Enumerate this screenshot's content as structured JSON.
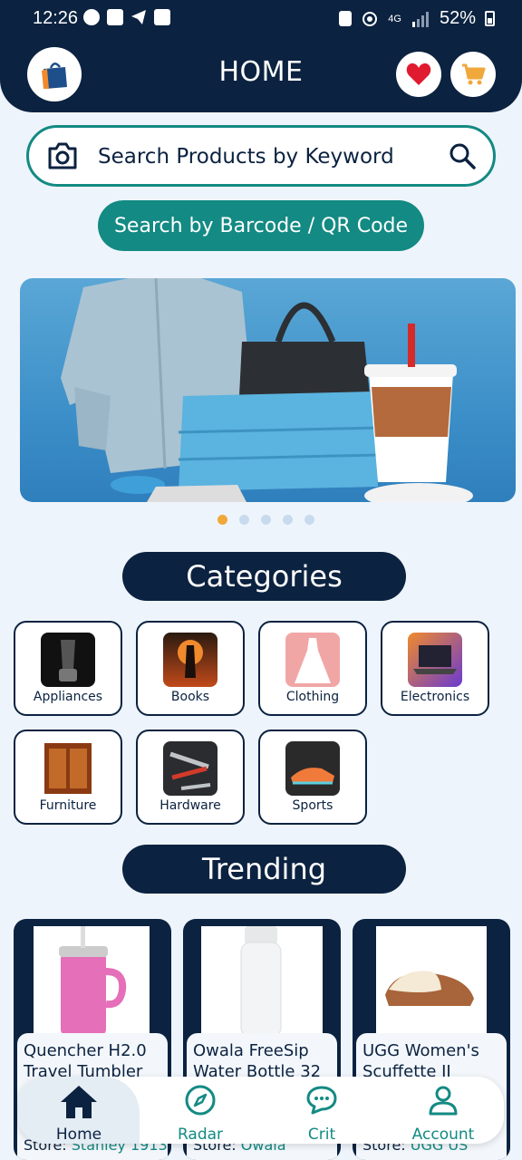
{
  "status": {
    "time": "12:26",
    "network": "4G",
    "battery": "52%"
  },
  "header": {
    "title": "HOME"
  },
  "search": {
    "placeholder": "Search Products by Keyword",
    "barcode_label": "Search by Barcode / QR Code"
  },
  "banner": {
    "slides": 5,
    "active_index": 0
  },
  "categories": {
    "title": "Categories",
    "items": [
      {
        "label": "Appliances"
      },
      {
        "label": "Books"
      },
      {
        "label": "Clothing"
      },
      {
        "label": "Electronics"
      },
      {
        "label": "Furniture"
      },
      {
        "label": "Hardware"
      },
      {
        "label": "Sports"
      }
    ]
  },
  "trending": {
    "title": "Trending",
    "items": [
      {
        "name_line1": "Quencher H2.0",
        "name_line2": "Travel Tumbler",
        "store_prefix": "Store: ",
        "store": "Stanley 1913"
      },
      {
        "name_line1": "Owala FreeSip",
        "name_line2": "Water Bottle 32 ...",
        "store_prefix": "Store: ",
        "store": "Owala"
      },
      {
        "name_line1": "UGG Women's",
        "name_line2": "Scuffette II Slip...",
        "store_prefix": "Store: ",
        "store": "UGG US"
      }
    ]
  },
  "nav": {
    "items": [
      {
        "label": "Home",
        "icon": "home-icon"
      },
      {
        "label": "Radar",
        "icon": "compass-icon"
      },
      {
        "label": "Crit",
        "icon": "chat-icon"
      },
      {
        "label": "Account",
        "icon": "user-icon"
      }
    ]
  },
  "colors": {
    "navy": "#0b2240",
    "teal": "#138a83",
    "accent": "#f0a83a",
    "heart": "#e01b2f"
  }
}
